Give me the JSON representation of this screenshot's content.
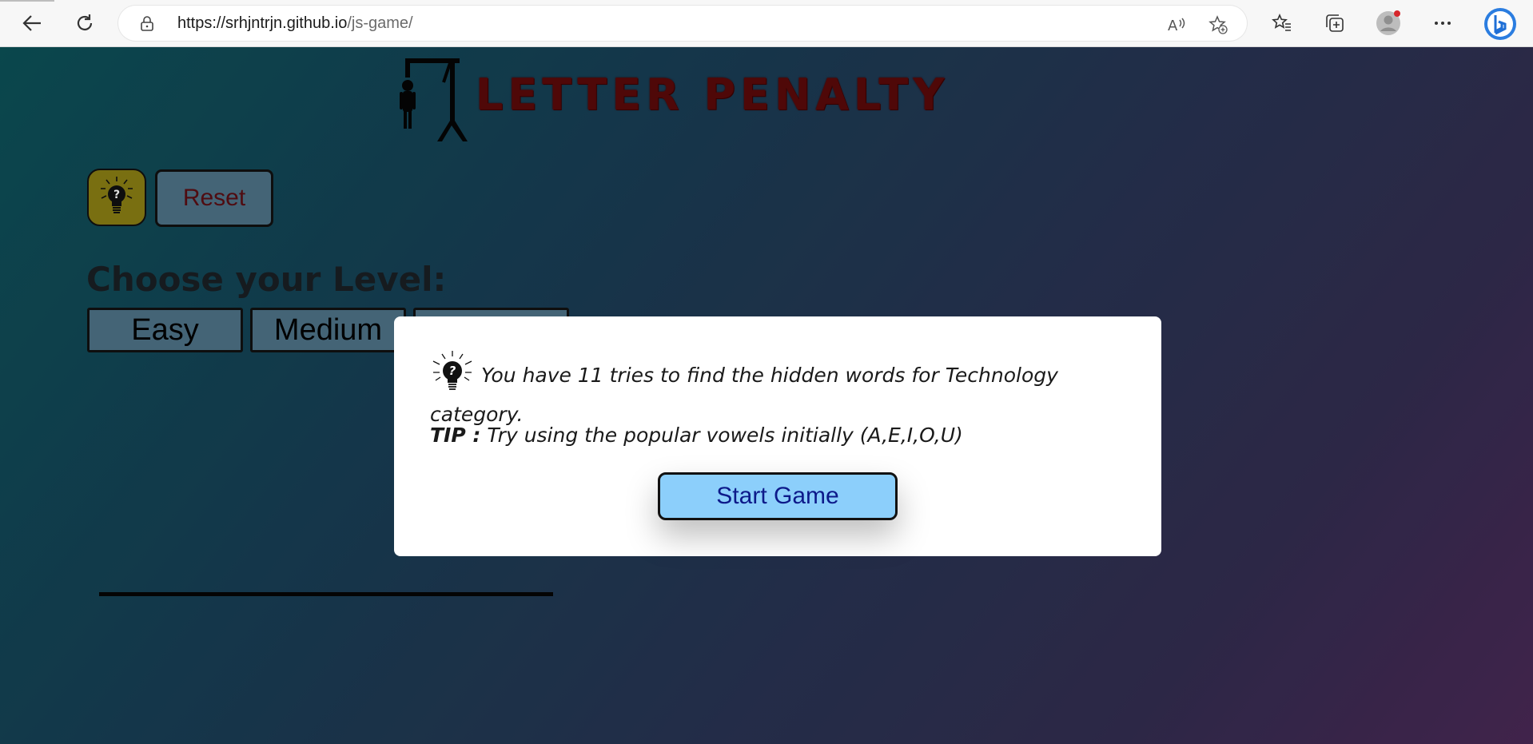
{
  "browser": {
    "url_host": "https://srhjntrjn.github.io",
    "url_path": "/js-game/",
    "icons": [
      "back-arrow-icon",
      "refresh-icon",
      "lock-icon",
      "read-aloud-icon",
      "add-favorite-icon",
      "favorites-icon",
      "collections-icon",
      "profile-avatar-icon",
      "more-icon",
      "bing-icon"
    ]
  },
  "game": {
    "title": "LETTER PENALTY",
    "reset_label": "Reset",
    "level_heading": "Choose your Level:",
    "levels": [
      "Easy",
      "Medium"
    ]
  },
  "modal": {
    "message": "You have 11 tries to find the hidden words for Technology category.",
    "tip_label": "TIP :",
    "tip_text": " Try using the popular vowels initially (A,E,I,O,U)",
    "start_label": "Start Game"
  },
  "colors": {
    "title": "#5a0a0a",
    "hint_button": "#8a7f14",
    "level_button": "#4e7287",
    "start_button": "#8ccffb"
  }
}
